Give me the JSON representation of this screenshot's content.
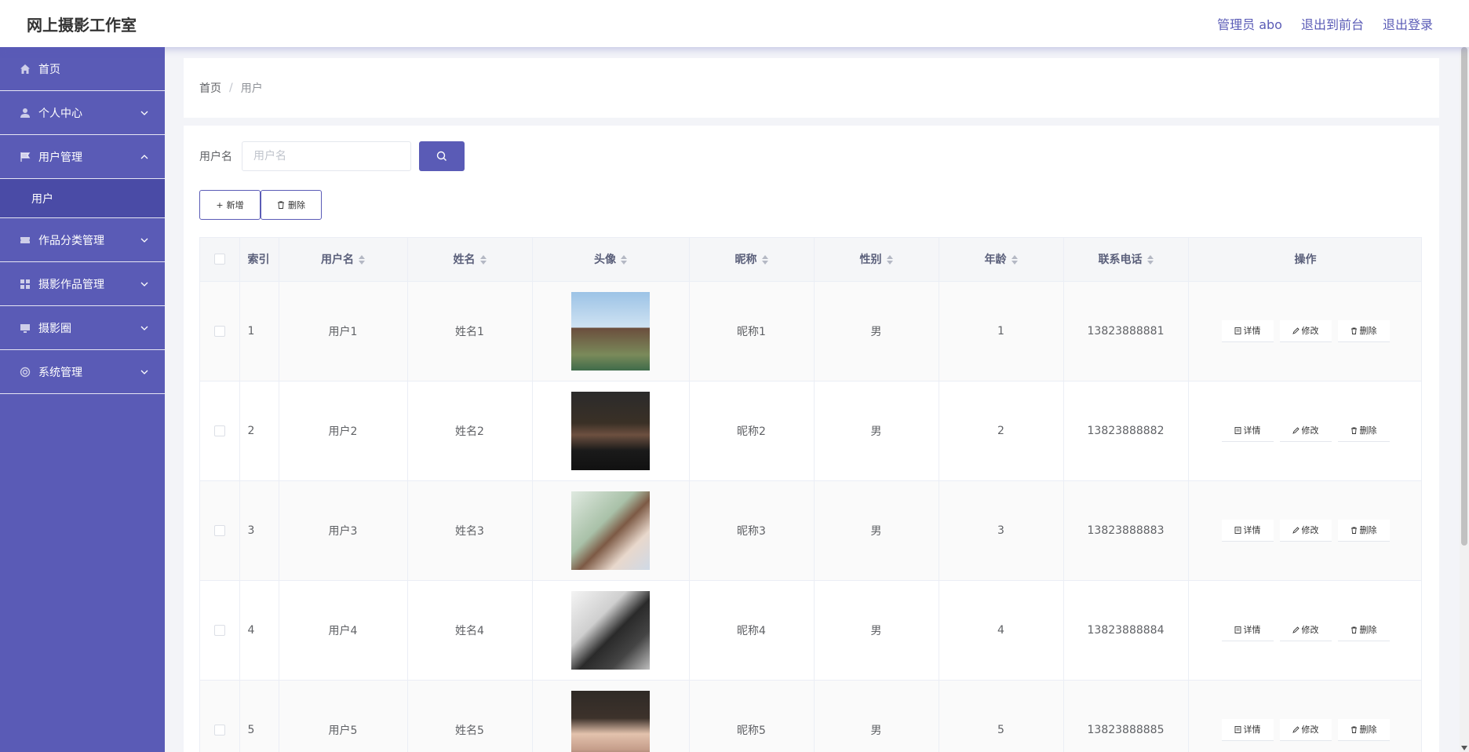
{
  "app": {
    "title": "网上摄影工作室"
  },
  "top_links": {
    "admin": "管理员 abo",
    "front": "退出到前台",
    "logout": "退出登录"
  },
  "sidebar": {
    "items": [
      {
        "label": "首页",
        "icon": "home-icon"
      },
      {
        "label": "个人中心",
        "icon": "user-icon"
      },
      {
        "label": "用户管理",
        "icon": "flag-icon"
      },
      {
        "label": "作品分类管理",
        "icon": "ticket-icon"
      },
      {
        "label": "摄影作品管理",
        "icon": "grid-icon"
      },
      {
        "label": "摄影圈",
        "icon": "monitor-icon"
      },
      {
        "label": "系统管理",
        "icon": "settings-icon"
      }
    ],
    "submenu": {
      "label": "用户"
    }
  },
  "breadcrumb": {
    "home": "首页",
    "sep": "/",
    "current": "用户"
  },
  "search": {
    "label": "用户名",
    "placeholder": "用户名"
  },
  "actions": {
    "add": "新增",
    "delete": "删除"
  },
  "table": {
    "headers": [
      "索引",
      "用户名",
      "姓名",
      "头像",
      "昵称",
      "性别",
      "年龄",
      "联系电话",
      "操作"
    ],
    "ops": {
      "detail": "详情",
      "edit": "修改",
      "delete": "删除"
    },
    "rows": [
      {
        "index": "1",
        "username": "用户1",
        "name": "姓名1",
        "nickname": "昵称1",
        "gender": "男",
        "age": "1",
        "phone": "13823888881"
      },
      {
        "index": "2",
        "username": "用户2",
        "name": "姓名2",
        "nickname": "昵称2",
        "gender": "男",
        "age": "2",
        "phone": "13823888882"
      },
      {
        "index": "3",
        "username": "用户3",
        "name": "姓名3",
        "nickname": "昵称3",
        "gender": "男",
        "age": "3",
        "phone": "13823888883"
      },
      {
        "index": "4",
        "username": "用户4",
        "name": "姓名4",
        "nickname": "昵称4",
        "gender": "男",
        "age": "4",
        "phone": "13823888884"
      },
      {
        "index": "5",
        "username": "用户5",
        "name": "姓名5",
        "nickname": "昵称5",
        "gender": "男",
        "age": "5",
        "phone": "13823888885"
      }
    ]
  },
  "colors": {
    "accent": "#5a5bb6",
    "sidebar_active": "#4a4ba6"
  }
}
